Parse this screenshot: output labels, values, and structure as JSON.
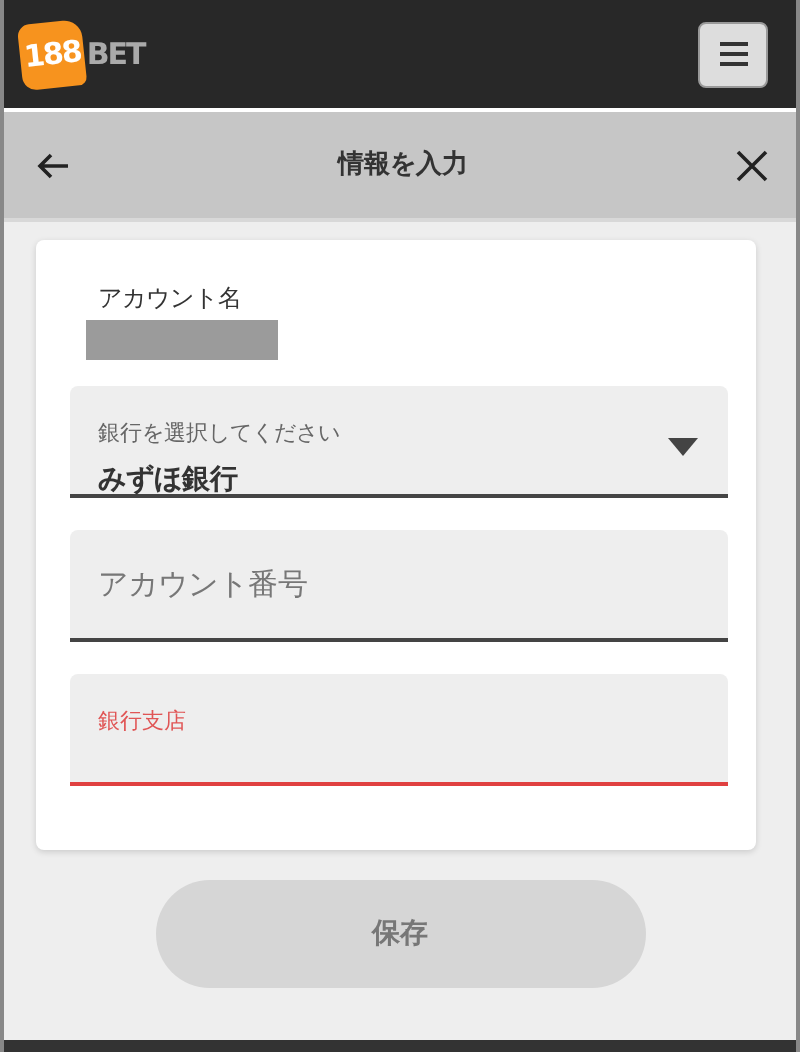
{
  "header": {
    "logo_number": "188",
    "logo_word": "BET"
  },
  "subheader": {
    "title": "情報を入力"
  },
  "account_name": {
    "label": "アカウント名",
    "redacted": true
  },
  "bank_select": {
    "label": "銀行を選択してください",
    "value": "みずほ銀行"
  },
  "fields": [
    {
      "placeholder": "アカウント番号",
      "error": false,
      "kind": "placeholder"
    },
    {
      "label": "銀行支店",
      "error": true,
      "kind": "floating"
    }
  ],
  "save_button": {
    "label": "保存",
    "disabled": true
  }
}
